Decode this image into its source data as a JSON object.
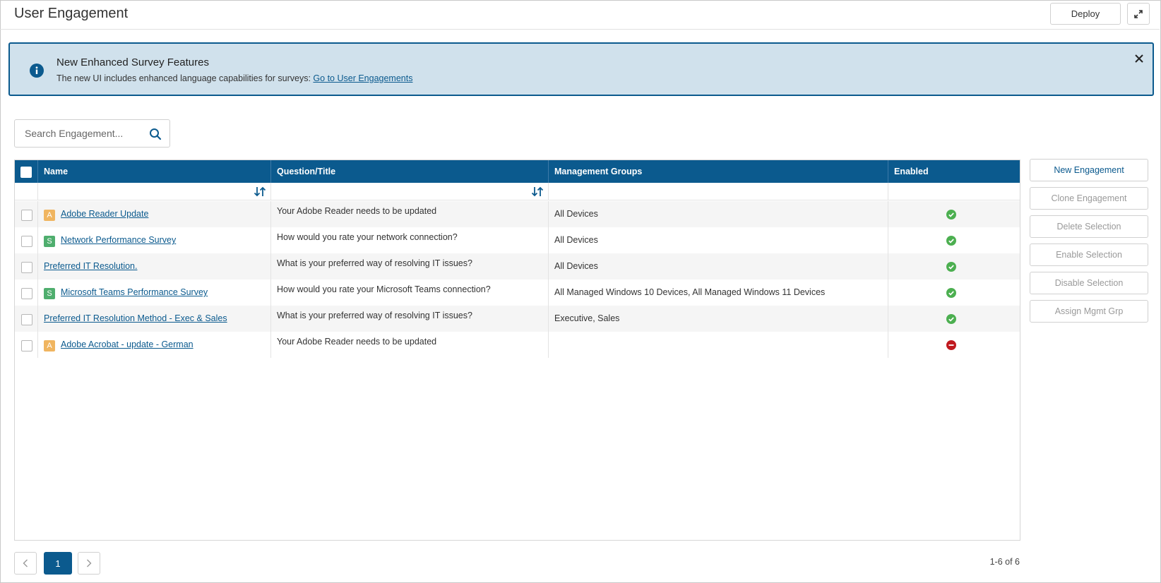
{
  "header": {
    "title": "User Engagement",
    "deploy_label": "Deploy"
  },
  "banner": {
    "title": "New Enhanced Survey Features",
    "text": "The new UI includes enhanced language capabilities for surveys: ",
    "link": "Go to User Engagements"
  },
  "search": {
    "placeholder": "Search Engagement...",
    "value": ""
  },
  "table": {
    "columns": [
      "Name",
      "Question/Title",
      "Management Groups",
      "Enabled"
    ],
    "rows": [
      {
        "badge": "A",
        "name": "Adobe Reader Update",
        "question": "Your Adobe Reader needs to be updated",
        "groups": "All Devices",
        "enabled": true
      },
      {
        "badge": "S",
        "name": "Network Performance Survey",
        "question": "How would you rate your network connection?",
        "groups": "All Devices",
        "enabled": true
      },
      {
        "badge": "",
        "name": "Preferred IT Resolution.",
        "question": "What is your preferred way of resolving IT issues?",
        "groups": "All Devices",
        "enabled": true
      },
      {
        "badge": "S",
        "name": "Microsoft Teams Performance Survey",
        "question": "How would you rate your Microsoft Teams connection?",
        "groups": "All Managed Windows 10 Devices, All Managed Windows 11 Devices",
        "enabled": true
      },
      {
        "badge": "",
        "name": "Preferred IT Resolution Method - Exec & Sales",
        "question": "What is your preferred way of resolving IT issues?",
        "groups": "Executive, Sales",
        "enabled": true
      },
      {
        "badge": "A",
        "name": "Adobe Acrobat - update - German",
        "question": "Your Adobe Reader needs to be updated",
        "groups": "",
        "enabled": false
      }
    ]
  },
  "actions": {
    "new_engagement": "New Engagement",
    "clone_engagement": "Clone Engagement",
    "delete_selection": "Delete Selection",
    "enable_selection": "Enable Selection",
    "disable_selection": "Disable Selection",
    "assign_mgmt_grp": "Assign Mgmt Grp"
  },
  "pagination": {
    "current_page": "1",
    "summary": "1-6 of 6"
  },
  "colors": {
    "brand": "#0b5a8e",
    "banner_bg": "#d0e1ec",
    "enabled": "#4caf50",
    "disabled": "#c0191f",
    "badge_a": "#f0b560",
    "badge_s": "#4fae6e"
  }
}
